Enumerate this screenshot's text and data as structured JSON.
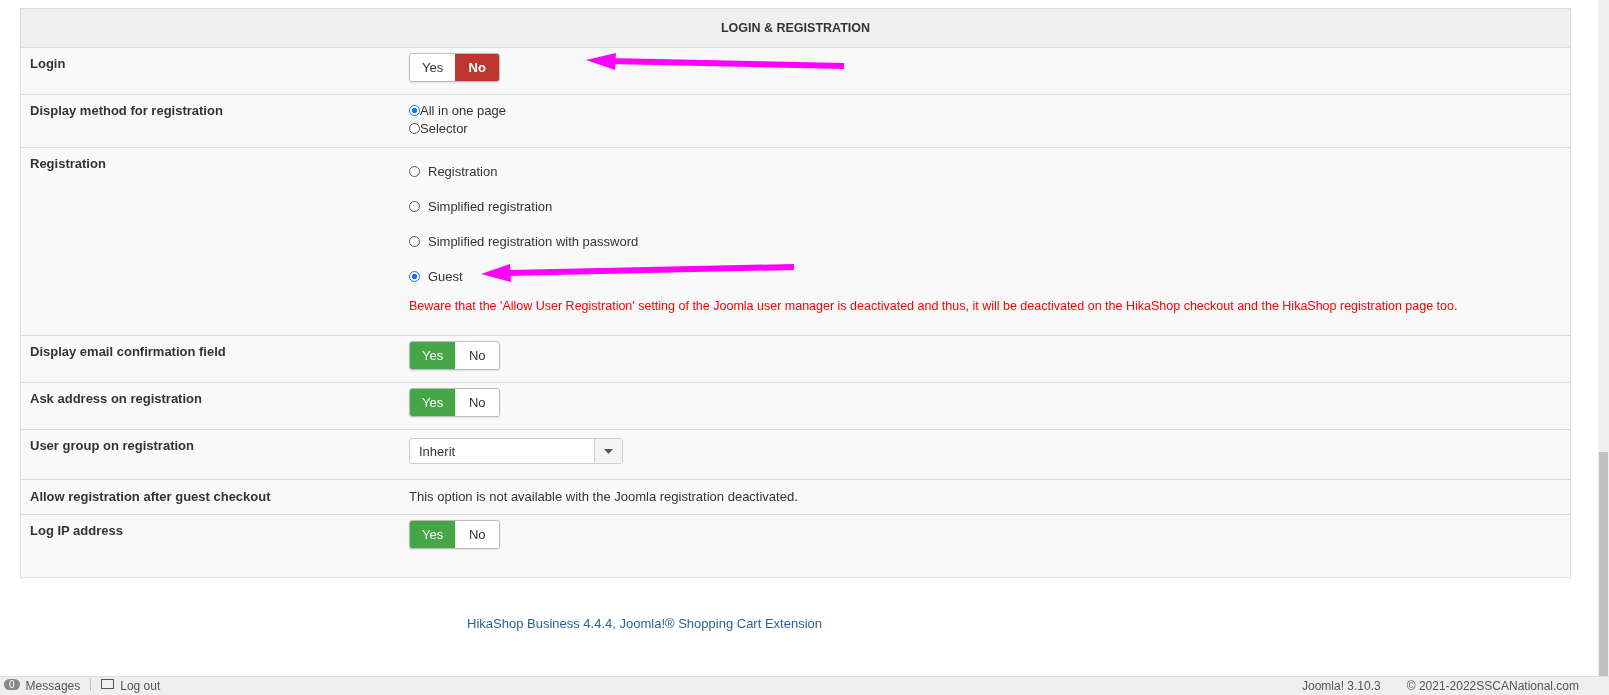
{
  "section": {
    "title": "LOGIN & REGISTRATION"
  },
  "rows": [
    {
      "kind": "toggle",
      "label": "Login",
      "options": [
        {
          "label": "Yes",
          "selected": false
        },
        {
          "label": "No",
          "selected": true
        }
      ]
    },
    {
      "kind": "radio_compact",
      "label": "Display method for registration",
      "options": [
        {
          "label": "All in one page",
          "selected": true
        },
        {
          "label": "Selector",
          "selected": false
        }
      ]
    },
    {
      "kind": "radio",
      "label": "Registration",
      "options": [
        {
          "label": "Registration",
          "selected": false
        },
        {
          "label": "Simplified registration",
          "selected": false
        },
        {
          "label": "Simplified registration with password",
          "selected": false
        },
        {
          "label": "Guest",
          "selected": true
        }
      ],
      "warning": "Beware that the 'Allow User Registration' setting of the Joomla user manager is deactivated and thus, it will be deactivated on the HikaShop checkout and the HikaShop registration page too."
    },
    {
      "kind": "toggle",
      "label": "Display email confirmation field",
      "options": [
        {
          "label": "Yes",
          "selected": true
        },
        {
          "label": "No",
          "selected": false
        }
      ]
    },
    {
      "kind": "toggle",
      "label": "Ask address on registration",
      "options": [
        {
          "label": "Yes",
          "selected": true
        },
        {
          "label": "No",
          "selected": false
        }
      ]
    },
    {
      "kind": "select",
      "label": "User group on registration",
      "value": "Inherit"
    },
    {
      "kind": "text",
      "label": "Allow registration after guest checkout",
      "text": "This option is not available with the Joomla registration deactivated."
    },
    {
      "kind": "toggle",
      "label": "Log IP address",
      "options": [
        {
          "label": "Yes",
          "selected": true
        },
        {
          "label": "No",
          "selected": false
        }
      ]
    }
  ],
  "footer": {
    "link": "HikaShop Business 4.4.4, Joomla!® Shopping Cart Extension"
  },
  "status_bar": {
    "badge": "0",
    "messages": "Messages",
    "logout": "Log out",
    "version": "Joomla! 3.10.3",
    "copyright": "© 2021-2022SSCANational.com"
  }
}
